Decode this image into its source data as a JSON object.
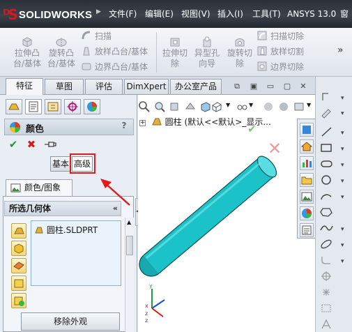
{
  "app": {
    "brand": "SOLIDWORKS",
    "menu": [
      "文件(F)",
      "编辑(E)",
      "视图(V)",
      "插入(I)",
      "工具(T)",
      "ANSYS 13.0",
      "窗"
    ]
  },
  "ribbon": {
    "big_buttons": [
      {
        "label_line1": "拉伸凸",
        "label_line2": "台/基体",
        "icon": "extruded-boss-icon"
      },
      {
        "label_line1": "旋转凸",
        "label_line2": "台/基体",
        "icon": "revolved-boss-icon"
      },
      {
        "label_line1": "拉伸切",
        "label_line2": "除",
        "icon": "extruded-cut-icon"
      },
      {
        "label_line1": "异型孔",
        "label_line2": "向导",
        "icon": "hole-wizard-icon"
      },
      {
        "label_line1": "旋转切",
        "label_line2": "除",
        "icon": "revolved-cut-icon"
      }
    ],
    "small_buttons_left": [
      {
        "label": "扫描",
        "icon": "sweep-icon"
      },
      {
        "label": "放样凸台/基体",
        "icon": "loft-icon"
      },
      {
        "label": "边界凸台/基体",
        "icon": "boundary-boss-icon"
      }
    ],
    "small_buttons_right": [
      {
        "label": "扫描切除",
        "icon": "swept-cut-icon"
      },
      {
        "label": "放样切割",
        "icon": "lofted-cut-icon"
      },
      {
        "label": "边界切除",
        "icon": "boundary-cut-icon"
      }
    ],
    "more": "»"
  },
  "tabs": [
    "特征",
    "草图",
    "评估",
    "DimXpert",
    "办公室产品"
  ],
  "active_tab": "特征",
  "property_manager": {
    "title": "颜色",
    "help": "?",
    "basic_label": "基本",
    "advanced_label": "高级",
    "subtab_label": "颜色/图象",
    "selection_group": {
      "title": "所选几何体",
      "collapse": "«",
      "items": [
        "圆柱.SLDPRT"
      ]
    },
    "remove_button": "移除外观"
  },
  "feature_tree": {
    "plus": "+",
    "text": "圆柱  (默认<<默认>_显示..."
  },
  "colors": {
    "cylinder": "#1bc3c9",
    "highlight": "#e11a1a",
    "brand_red": "#d3181f"
  }
}
